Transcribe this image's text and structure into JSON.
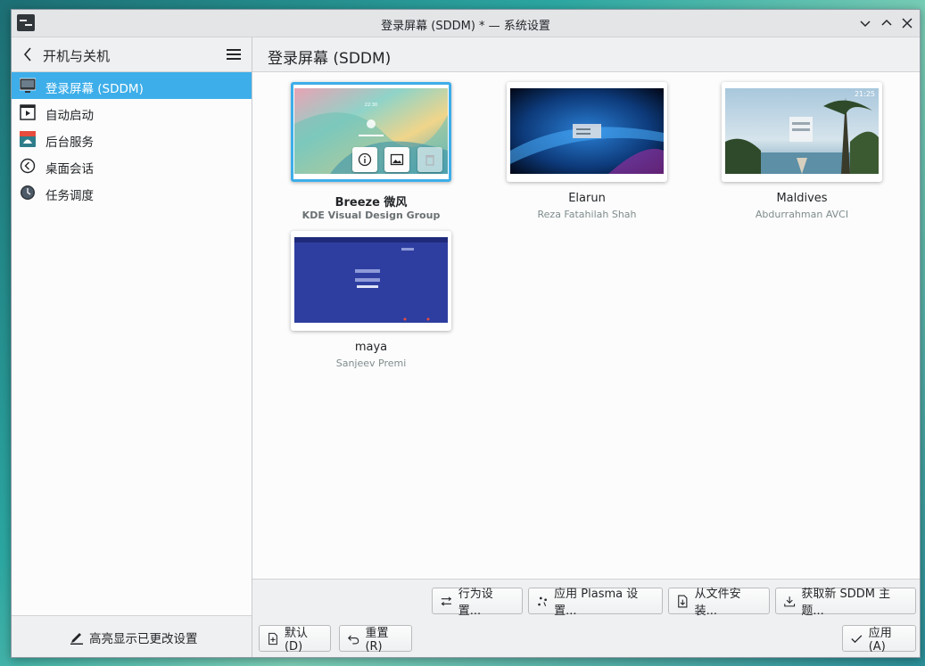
{
  "window": {
    "title": "登录屏幕 (SDDM) * — 系统设置"
  },
  "sidebar": {
    "title": "开机与关机",
    "items": [
      {
        "label": "登录屏幕 (SDDM)",
        "icon": "monitor-icon",
        "active": true
      },
      {
        "label": "自动启动",
        "icon": "autostart-icon",
        "active": false
      },
      {
        "label": "后台服务",
        "icon": "services-icon",
        "active": false
      },
      {
        "label": "桌面会话",
        "icon": "session-icon",
        "active": false
      },
      {
        "label": "任务调度",
        "icon": "clock-icon",
        "active": false
      }
    ],
    "footer_label": "高亮显示已更改设置"
  },
  "main": {
    "title": "登录屏幕 (SDDM)",
    "themes": [
      {
        "name": "Breeze 微风",
        "author": "KDE Visual Design Group",
        "selected": true,
        "clock": "22:30"
      },
      {
        "name": "Elarun",
        "author": "Reza Fatahilah Shah",
        "selected": false
      },
      {
        "name": "Maldives",
        "author": "Abdurrahman AVCI",
        "selected": false,
        "clock": "21:25"
      },
      {
        "name": "maya",
        "author": "Sanjeev Premi",
        "selected": false
      }
    ]
  },
  "toolbar": {
    "behavior": "行为设置...",
    "apply_plasma": "应用 Plasma 设置...",
    "install_file": "从文件安装...",
    "get_new": "获取新 SDDM 主题...",
    "defaults": "默认(D)",
    "reset": "重置(R)",
    "apply": "应用(A)"
  },
  "colors": {
    "accent": "#3daee9",
    "window_bg": "#eff0f1",
    "view_bg": "#fcfcfc",
    "author_text": "#7f8c8d"
  }
}
